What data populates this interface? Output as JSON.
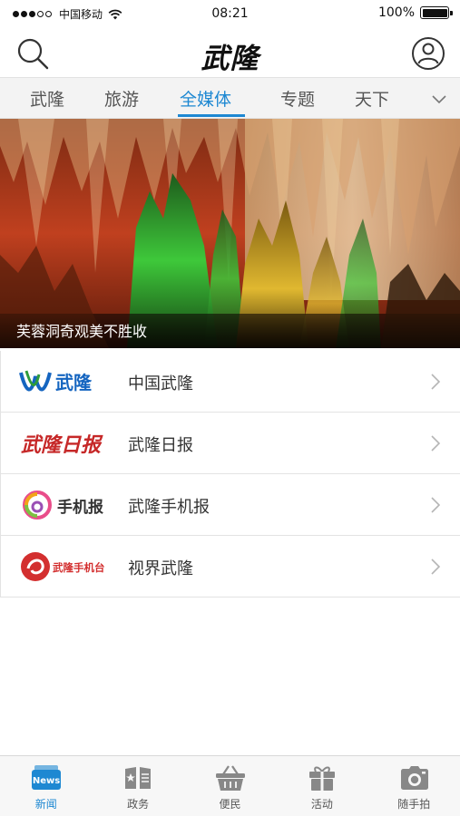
{
  "status_bar": {
    "carrier": "中国移动",
    "time": "08:21",
    "battery": "100%"
  },
  "header": {
    "logo_text": "武隆"
  },
  "tabs": [
    {
      "label": "武隆",
      "active": false
    },
    {
      "label": "旅游",
      "active": false
    },
    {
      "label": "全媒体",
      "active": true
    },
    {
      "label": "专题",
      "active": false
    },
    {
      "label": "天下",
      "active": false
    }
  ],
  "banner": {
    "caption": "芙蓉洞奇观美不胜收"
  },
  "media_list": [
    {
      "label": "中国武隆",
      "logo_text": "武隆",
      "logo_color": "#1565c0"
    },
    {
      "label": "武隆日报",
      "logo_text": "武隆日报",
      "logo_color": "#c62828"
    },
    {
      "label": "武隆手机报",
      "logo_text": "手机报",
      "logo_color": "#333333"
    },
    {
      "label": "视界武隆",
      "logo_text": "武隆手机台",
      "logo_color": "#d32f2f"
    }
  ],
  "bottom_nav": [
    {
      "label": "新闻",
      "icon": "news-icon",
      "active": true,
      "badge": "News"
    },
    {
      "label": "政务",
      "icon": "government-book-icon",
      "active": false
    },
    {
      "label": "便民",
      "icon": "basket-icon",
      "active": false
    },
    {
      "label": "活动",
      "icon": "gift-icon",
      "active": false
    },
    {
      "label": "随手拍",
      "icon": "camera-icon",
      "active": false
    }
  ],
  "colors": {
    "accent": "#1e88d2",
    "text": "#333333"
  }
}
